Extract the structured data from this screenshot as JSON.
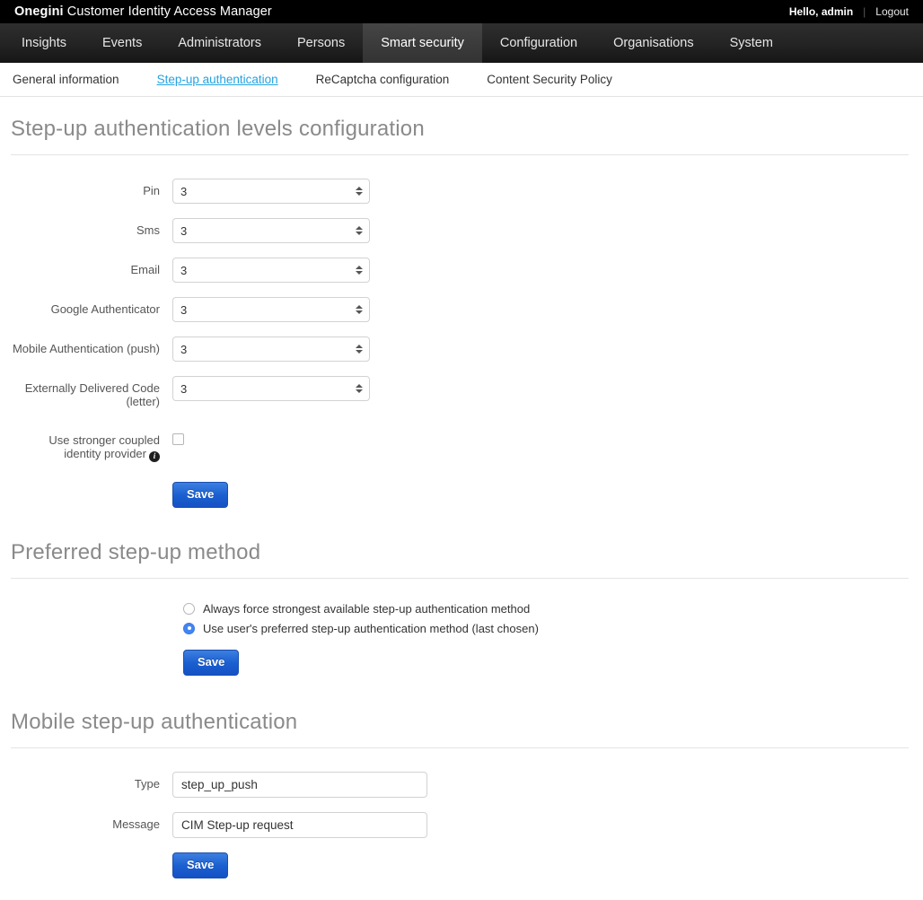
{
  "topbar": {
    "brand_bold": "Onegini",
    "brand_rest": " Customer Identity Access Manager",
    "hello": "Hello, admin",
    "separator": "|",
    "logout": "Logout"
  },
  "mainnav": {
    "items": [
      {
        "label": "Insights",
        "active": false
      },
      {
        "label": "Events",
        "active": false
      },
      {
        "label": "Administrators",
        "active": false
      },
      {
        "label": "Persons",
        "active": false
      },
      {
        "label": "Smart security",
        "active": true
      },
      {
        "label": "Configuration",
        "active": false
      },
      {
        "label": "Organisations",
        "active": false
      },
      {
        "label": "System",
        "active": false
      }
    ]
  },
  "subnav": {
    "items": [
      {
        "label": "General information",
        "active": false
      },
      {
        "label": "Step-up authentication",
        "active": true
      },
      {
        "label": "ReCaptcha configuration",
        "active": false
      },
      {
        "label": "Content Security Policy",
        "active": false
      }
    ]
  },
  "levels_section": {
    "title": "Step-up authentication levels configuration",
    "fields": [
      {
        "label": "Pin",
        "value": "3"
      },
      {
        "label": "Sms",
        "value": "3"
      },
      {
        "label": "Email",
        "value": "3"
      },
      {
        "label": "Google Authenticator",
        "value": "3"
      },
      {
        "label": "Mobile Authentication (push)",
        "value": "3"
      },
      {
        "label": "Externally Delivered Code (letter)",
        "value": "3"
      }
    ],
    "checkbox_label": "Use stronger coupled identity provider",
    "checkbox_info_icon": "info-icon",
    "checkbox_checked": false,
    "save_label": "Save"
  },
  "preferred_section": {
    "title": "Preferred step-up method",
    "options": [
      {
        "label": "Always force strongest available step-up authentication method",
        "selected": false
      },
      {
        "label": "Use user's preferred step-up authentication method (last chosen)",
        "selected": true
      }
    ],
    "save_label": "Save"
  },
  "mobile_section": {
    "title": "Mobile step-up authentication",
    "type_label": "Type",
    "type_value": "step_up_push",
    "message_label": "Message",
    "message_value": "CIM Step-up request",
    "save_label": "Save"
  },
  "colors": {
    "topbar_bg": "#000000",
    "nav_bg": "#232323",
    "nav_active_bg": "#3a3a3a",
    "link_active": "#23a3e0",
    "button_blue": "#1a5fd0",
    "radio_blue": "#4285f4",
    "heading_gray": "#8a8a8a"
  }
}
